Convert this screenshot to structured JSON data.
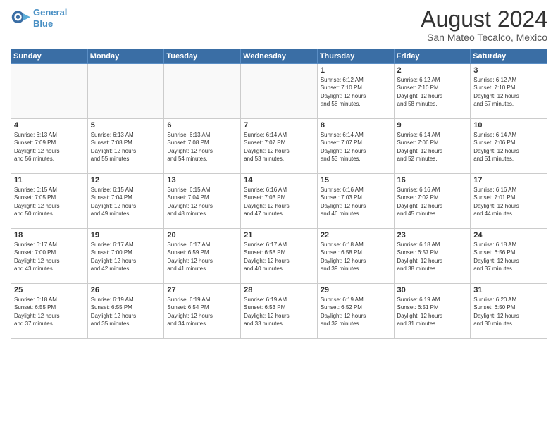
{
  "header": {
    "logo_line1": "General",
    "logo_line2": "Blue",
    "title": "August 2024",
    "subtitle": "San Mateo Tecalco, Mexico"
  },
  "days_of_week": [
    "Sunday",
    "Monday",
    "Tuesday",
    "Wednesday",
    "Thursday",
    "Friday",
    "Saturday"
  ],
  "weeks": [
    [
      {
        "day": "",
        "info": ""
      },
      {
        "day": "",
        "info": ""
      },
      {
        "day": "",
        "info": ""
      },
      {
        "day": "",
        "info": ""
      },
      {
        "day": "1",
        "info": "Sunrise: 6:12 AM\nSunset: 7:10 PM\nDaylight: 12 hours\nand 58 minutes."
      },
      {
        "day": "2",
        "info": "Sunrise: 6:12 AM\nSunset: 7:10 PM\nDaylight: 12 hours\nand 58 minutes."
      },
      {
        "day": "3",
        "info": "Sunrise: 6:12 AM\nSunset: 7:10 PM\nDaylight: 12 hours\nand 57 minutes."
      }
    ],
    [
      {
        "day": "4",
        "info": "Sunrise: 6:13 AM\nSunset: 7:09 PM\nDaylight: 12 hours\nand 56 minutes."
      },
      {
        "day": "5",
        "info": "Sunrise: 6:13 AM\nSunset: 7:08 PM\nDaylight: 12 hours\nand 55 minutes."
      },
      {
        "day": "6",
        "info": "Sunrise: 6:13 AM\nSunset: 7:08 PM\nDaylight: 12 hours\nand 54 minutes."
      },
      {
        "day": "7",
        "info": "Sunrise: 6:14 AM\nSunset: 7:07 PM\nDaylight: 12 hours\nand 53 minutes."
      },
      {
        "day": "8",
        "info": "Sunrise: 6:14 AM\nSunset: 7:07 PM\nDaylight: 12 hours\nand 53 minutes."
      },
      {
        "day": "9",
        "info": "Sunrise: 6:14 AM\nSunset: 7:06 PM\nDaylight: 12 hours\nand 52 minutes."
      },
      {
        "day": "10",
        "info": "Sunrise: 6:14 AM\nSunset: 7:06 PM\nDaylight: 12 hours\nand 51 minutes."
      }
    ],
    [
      {
        "day": "11",
        "info": "Sunrise: 6:15 AM\nSunset: 7:05 PM\nDaylight: 12 hours\nand 50 minutes."
      },
      {
        "day": "12",
        "info": "Sunrise: 6:15 AM\nSunset: 7:04 PM\nDaylight: 12 hours\nand 49 minutes."
      },
      {
        "day": "13",
        "info": "Sunrise: 6:15 AM\nSunset: 7:04 PM\nDaylight: 12 hours\nand 48 minutes."
      },
      {
        "day": "14",
        "info": "Sunrise: 6:16 AM\nSunset: 7:03 PM\nDaylight: 12 hours\nand 47 minutes."
      },
      {
        "day": "15",
        "info": "Sunrise: 6:16 AM\nSunset: 7:03 PM\nDaylight: 12 hours\nand 46 minutes."
      },
      {
        "day": "16",
        "info": "Sunrise: 6:16 AM\nSunset: 7:02 PM\nDaylight: 12 hours\nand 45 minutes."
      },
      {
        "day": "17",
        "info": "Sunrise: 6:16 AM\nSunset: 7:01 PM\nDaylight: 12 hours\nand 44 minutes."
      }
    ],
    [
      {
        "day": "18",
        "info": "Sunrise: 6:17 AM\nSunset: 7:00 PM\nDaylight: 12 hours\nand 43 minutes."
      },
      {
        "day": "19",
        "info": "Sunrise: 6:17 AM\nSunset: 7:00 PM\nDaylight: 12 hours\nand 42 minutes."
      },
      {
        "day": "20",
        "info": "Sunrise: 6:17 AM\nSunset: 6:59 PM\nDaylight: 12 hours\nand 41 minutes."
      },
      {
        "day": "21",
        "info": "Sunrise: 6:17 AM\nSunset: 6:58 PM\nDaylight: 12 hours\nand 40 minutes."
      },
      {
        "day": "22",
        "info": "Sunrise: 6:18 AM\nSunset: 6:58 PM\nDaylight: 12 hours\nand 39 minutes."
      },
      {
        "day": "23",
        "info": "Sunrise: 6:18 AM\nSunset: 6:57 PM\nDaylight: 12 hours\nand 38 minutes."
      },
      {
        "day": "24",
        "info": "Sunrise: 6:18 AM\nSunset: 6:56 PM\nDaylight: 12 hours\nand 37 minutes."
      }
    ],
    [
      {
        "day": "25",
        "info": "Sunrise: 6:18 AM\nSunset: 6:55 PM\nDaylight: 12 hours\nand 37 minutes."
      },
      {
        "day": "26",
        "info": "Sunrise: 6:19 AM\nSunset: 6:55 PM\nDaylight: 12 hours\nand 35 minutes."
      },
      {
        "day": "27",
        "info": "Sunrise: 6:19 AM\nSunset: 6:54 PM\nDaylight: 12 hours\nand 34 minutes."
      },
      {
        "day": "28",
        "info": "Sunrise: 6:19 AM\nSunset: 6:53 PM\nDaylight: 12 hours\nand 33 minutes."
      },
      {
        "day": "29",
        "info": "Sunrise: 6:19 AM\nSunset: 6:52 PM\nDaylight: 12 hours\nand 32 minutes."
      },
      {
        "day": "30",
        "info": "Sunrise: 6:19 AM\nSunset: 6:51 PM\nDaylight: 12 hours\nand 31 minutes."
      },
      {
        "day": "31",
        "info": "Sunrise: 6:20 AM\nSunset: 6:50 PM\nDaylight: 12 hours\nand 30 minutes."
      }
    ]
  ]
}
